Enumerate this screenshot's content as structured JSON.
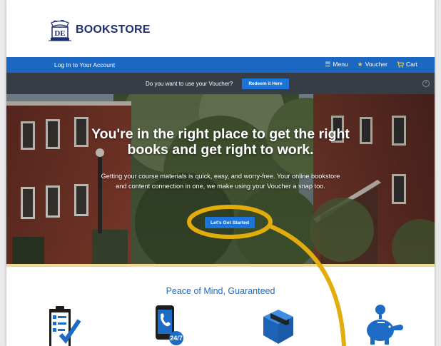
{
  "brand": {
    "name": "BOOKSTORE",
    "crest_letters": "DE"
  },
  "nav": {
    "login_label": "Log In to Your Account",
    "menu_label": "Menu",
    "voucher_label": "Voucher",
    "cart_label": "Cart"
  },
  "voucher_bar": {
    "prompt": "Do you want to use your Voucher?",
    "redeem_label": "Redeem it Here"
  },
  "hero": {
    "title_line1": "You're in the right place to get the right",
    "title_line2": "books and get right to work.",
    "subtitle_line1": "Getting your course materials is quick, easy, and worry-free. Your online bookstore",
    "subtitle_line2": "and content connection in one, we make using your Voucher a snap too.",
    "cta_label": "Let's Get Started"
  },
  "features": {
    "title": "Peace of Mind, Guaranteed",
    "items": [
      {
        "icon": "checklist-clipboard-icon"
      },
      {
        "icon": "phone-24-7-icon"
      },
      {
        "icon": "shipping-box-icon"
      },
      {
        "icon": "piggy-bank-icon"
      }
    ],
    "support_badge": "24/7"
  },
  "colors": {
    "nav_blue": "#1c67c2",
    "voucher_bar": "#363d45",
    "button_blue": "#1c74d8",
    "brand_navy": "#1e2f72",
    "annotation_gold": "#e2ac0c",
    "accent_blue": "#1d6bc4"
  }
}
